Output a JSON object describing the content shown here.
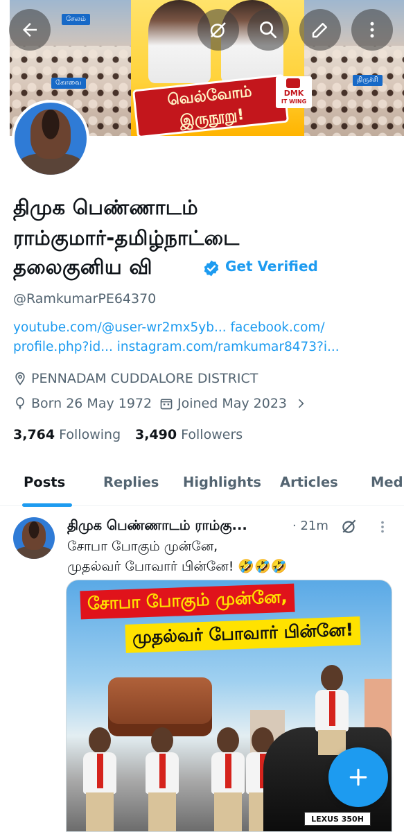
{
  "profile": {
    "name_lines": [
      "திமுக பெண்ணாடம்",
      "ராம்குமார்-தமிழ்நாட்டை",
      "தலைகுனிய வி"
    ],
    "get_verified": "Get Verified",
    "handle": "@RamkumarPE64370",
    "links": {
      "line1": "youtube.com/@user-wr2mx5yb... facebook.com/",
      "line2": "profile.php?id... instagram.com/ramkumar8473?i..."
    },
    "location": "PENNADAM CUDDALORE DISTRICT",
    "born": "Born 26 May 1972",
    "joined": "Joined May 2023",
    "following_count": "3,764",
    "following_label": "Following",
    "followers_count": "3,490",
    "followers_label": "Followers"
  },
  "banner": {
    "slogan_line1": "வெல்வோம்",
    "slogan_line2": "இருநூறு!",
    "badge_line1": "DMK",
    "badge_line2": "IT WING",
    "tag_left_top": "சேலம்",
    "tag_left_mid": "கோவை",
    "tag_right_mid": "திருச்சி"
  },
  "tabs": [
    "Posts",
    "Replies",
    "Highlights",
    "Articles",
    "Medi"
  ],
  "post": {
    "author": "திமுக பெண்ணாடம் ராம்கு...",
    "time": "· 21m",
    "text_line1": "சோபா போகும் முன்னே,",
    "text_line2": "முதல்வர் போவார் பின்னே! 🤣🤣🤣",
    "image_caption1": "சோபா போகும் முன்னே,",
    "image_caption2": "முதல்வர் போவார் பின்னே!",
    "image_plate": "LEXUS 350H"
  },
  "icons": {
    "back": "back-arrow-icon",
    "grok": "grok-icon",
    "search": "search-icon",
    "edit": "edit-icon",
    "more": "more-vertical-icon",
    "compose": "plus-icon"
  },
  "colors": {
    "accent": "#1d9bf0",
    "text": "#0f1419",
    "muted": "#536471"
  }
}
